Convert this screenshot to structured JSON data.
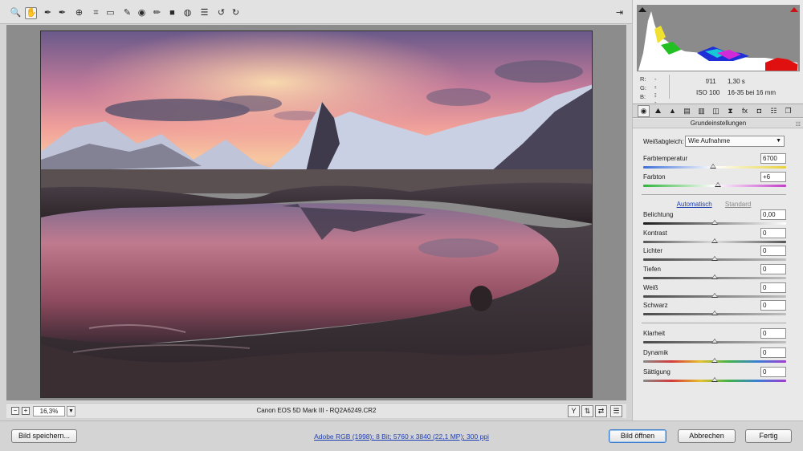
{
  "toolbar": {
    "tools": [
      {
        "name": "zoom-tool",
        "glyph": "🔍"
      },
      {
        "name": "hand-tool",
        "glyph": "✋"
      },
      {
        "name": "white-balance-tool",
        "glyph": "✒"
      },
      {
        "name": "color-sampler-tool",
        "glyph": "✒"
      },
      {
        "name": "targeted-adjustment-tool",
        "glyph": "⊕"
      },
      {
        "name": "crop-tool",
        "glyph": "⌗"
      },
      {
        "name": "straighten-tool",
        "glyph": "▭"
      },
      {
        "name": "spot-removal-tool",
        "glyph": "✎"
      },
      {
        "name": "red-eye-tool",
        "glyph": "◉"
      },
      {
        "name": "adjustment-brush-tool",
        "glyph": "✏"
      },
      {
        "name": "graduated-filter-tool",
        "glyph": "■"
      },
      {
        "name": "radial-filter-tool",
        "glyph": "◍"
      },
      {
        "name": "preferences-tool",
        "glyph": "☰"
      },
      {
        "name": "rotate-left-tool",
        "glyph": "↺"
      },
      {
        "name": "rotate-right-tool",
        "glyph": "↻"
      }
    ],
    "export_glyph": "⇥"
  },
  "status": {
    "zoom_value": "16,3%",
    "filename": "Canon EOS 5D Mark III - RQ2A6249.CR2"
  },
  "info": {
    "r_label": "R:",
    "g_label": "G:",
    "b_label": "B:",
    "r_value": "---",
    "g_value": "---",
    "b_value": "---",
    "aperture": "f/11",
    "shutter": "1,30 s",
    "iso": "ISO 100",
    "lens": "16-35 bei 16 mm"
  },
  "panel": {
    "tabs": [
      "◉",
      "⛰",
      "▲",
      "▤",
      "▥",
      "◫",
      "⧗",
      "fx",
      "◘",
      "☷",
      "❐"
    ],
    "section_title": "Grundeinstellungen",
    "menu_glyph": "☷",
    "white_balance_label": "Weißabgleich:",
    "white_balance_value": "Wie Aufnahme",
    "auto_label": "Automatisch",
    "standard_label": "Standard"
  },
  "sliders": [
    {
      "label": "Farbtemperatur",
      "value": "6700",
      "pos": 0.49,
      "track": "temp"
    },
    {
      "label": "Farbton",
      "value": "+6",
      "pos": 0.52,
      "track": "tint"
    },
    {
      "label": "Belichtung",
      "value": "0,00",
      "pos": 0.5,
      "track": "exposure"
    },
    {
      "label": "Kontrast",
      "value": "0",
      "pos": 0.5,
      "track": "contrast"
    },
    {
      "label": "Lichter",
      "value": "0",
      "pos": 0.5,
      "track": "gray"
    },
    {
      "label": "Tiefen",
      "value": "0",
      "pos": 0.5,
      "track": "gray"
    },
    {
      "label": "Weiß",
      "value": "0",
      "pos": 0.5,
      "track": "gray"
    },
    {
      "label": "Schwarz",
      "value": "0",
      "pos": 0.5,
      "track": "gray"
    },
    {
      "label": "Klarheit",
      "value": "0",
      "pos": 0.5,
      "track": "gray"
    },
    {
      "label": "Dynamik",
      "value": "0",
      "pos": 0.5,
      "track": "rainbow"
    },
    {
      "label": "Sättigung",
      "value": "0",
      "pos": 0.5,
      "track": "rainbow"
    }
  ],
  "footer": {
    "save_label": "Bild speichern...",
    "workflow_link": "Adobe RGB (1998); 8 Bit; 5760 x 3840 (22,1 MP); 300 ppi",
    "open_label": "Bild öffnen",
    "cancel_label": "Abbrechen",
    "done_label": "Fertig"
  }
}
